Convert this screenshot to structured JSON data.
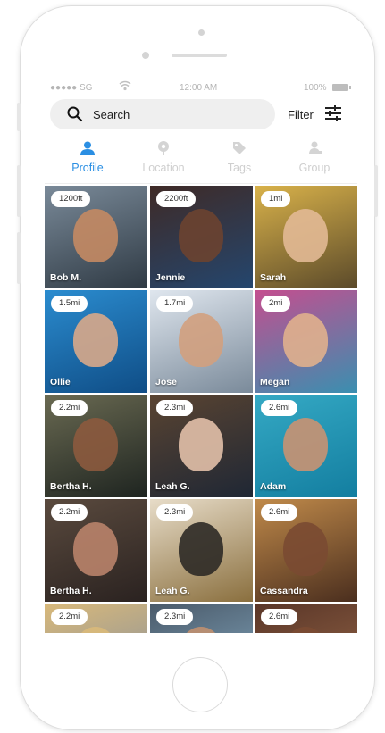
{
  "status": {
    "carrier": "●●●●● SG",
    "time": "12:00 AM",
    "battery": "100%"
  },
  "search": {
    "label": "Search",
    "filter_label": "Filter"
  },
  "tabs": [
    {
      "label": "Profile",
      "active": true,
      "icon": "person-icon"
    },
    {
      "label": "Location",
      "active": false,
      "icon": "location-pin-icon"
    },
    {
      "label": "Tags",
      "active": false,
      "icon": "tag-icon"
    },
    {
      "label": "Group",
      "active": false,
      "icon": "group-icon"
    }
  ],
  "colors": {
    "accent": "#2b8fe3",
    "inactive": "#cfcfcf"
  },
  "people": [
    {
      "distance": "1200ft",
      "name": "Bob M.",
      "bg1": "#7a8a99",
      "bg2": "#2f3a44",
      "face": "#c48a63"
    },
    {
      "distance": "2200ft",
      "name": "Jennie",
      "bg1": "#3f2a26",
      "bg2": "#24466e",
      "face": "#6b4330"
    },
    {
      "distance": "1mi",
      "name": "Sarah",
      "bg1": "#d9b24a",
      "bg2": "#5b4a2a",
      "face": "#e2b995"
    },
    {
      "distance": "1.5mi",
      "name": "Ollie",
      "bg1": "#2b8ccf",
      "bg2": "#0f4d86",
      "face": "#d8a88a"
    },
    {
      "distance": "1.7mi",
      "name": "Jose",
      "bg1": "#dfe6ee",
      "bg2": "#7a8a9a",
      "face": "#d2a07e"
    },
    {
      "distance": "2mi",
      "name": "Megan",
      "bg1": "#c44e8f",
      "bg2": "#3a8fb0",
      "face": "#e0b08d"
    },
    {
      "distance": "2.2mi",
      "name": "Bertha H.",
      "bg1": "#6a6a52",
      "bg2": "#1e2420",
      "face": "#8c5a3e"
    },
    {
      "distance": "2.3mi",
      "name": "Leah G.",
      "bg1": "#5a4432",
      "bg2": "#1f2734",
      "face": "#e2c0a8"
    },
    {
      "distance": "2.6mi",
      "name": "Adam",
      "bg1": "#35a9c4",
      "bg2": "#137ea0",
      "face": "#c99272"
    },
    {
      "distance": "2.2mi",
      "name": "Bertha H.",
      "bg1": "#5a4a3e",
      "bg2": "#2a2220",
      "face": "#b9836a"
    },
    {
      "distance": "2.3mi",
      "name": "Leah G.",
      "bg1": "#e7dcc8",
      "bg2": "#8a6f3e",
      "face": "#2e2a26"
    },
    {
      "distance": "2.6mi",
      "name": "Cassandra",
      "bg1": "#c08a4a",
      "bg2": "#4a2e1e",
      "face": "#7a4a32"
    },
    {
      "distance": "2.2mi",
      "name": "",
      "bg1": "#d9b97a",
      "bg2": "#7c8aa0",
      "face": "#d9b97a"
    },
    {
      "distance": "2.3mi",
      "name": "",
      "bg1": "#4a5a6a",
      "bg2": "#8ab0c8",
      "face": "#c09070"
    },
    {
      "distance": "2.6mi",
      "name": "",
      "bg1": "#5a3628",
      "bg2": "#9a6a4a",
      "face": "#7a4a32"
    }
  ]
}
